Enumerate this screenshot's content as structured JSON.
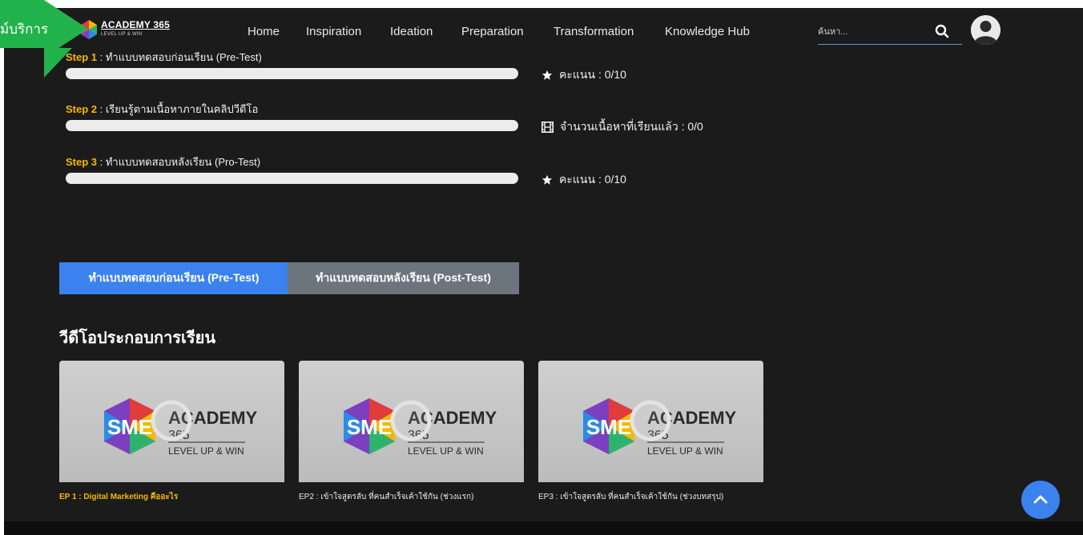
{
  "nav": {
    "brand": "ACADEMY 365",
    "tagline": "LEVEL UP & WIN",
    "links": [
      "Home",
      "Inspiration",
      "Ideation",
      "Preparation",
      "Transformation",
      "Knowledge Hub"
    ],
    "search_placeholder": "ค้นหา..."
  },
  "overlay": {
    "text": "ม์บริการ"
  },
  "steps": [
    {
      "number": "Step 1",
      "title": " : ทำแบบทดสอบก่อนเรียน (Pre-Test)",
      "meta_icon": "star-icon",
      "meta": "คะแนน : 0/10",
      "progress": 0
    },
    {
      "number": "Step 2",
      "title": " : เรียนรู้ตามเนื้อหาภายในคลิปวีดีโอ",
      "meta_icon": "film-icon",
      "meta": "จำนวนเนื้อหาที่เรียนแล้ว : 0/0",
      "progress": 0
    },
    {
      "number": "Step 3",
      "title": " : ทำแบบทดสอบหลังเรียน (Pro-Test)",
      "meta_icon": "star-icon",
      "meta": "คะแนน : 0/10",
      "progress": 0
    }
  ],
  "buttons": {
    "pre_test": "ทำแบบทดสอบก่อนเรียน (Pre-Test)",
    "post_test": "ทำแบบทดสอบหลังเรียน (Post-Test)"
  },
  "videos": {
    "section_title": "วีดีโอประกอบการเรียน",
    "thumbnail_logo": {
      "left": "SME",
      "right": "ACADEMY",
      "middle": "365",
      "bottom": "LEVEL UP & WIN"
    },
    "items": [
      {
        "title": "EP 1 : Digital Marketing คืออะไร",
        "active": true
      },
      {
        "title": "EP2 : เข้าใจสูตรลับ ที่คนสำเร็จเค้าใช้กัน (ช่วงแรก)",
        "active": false
      },
      {
        "title": "EP3 : เข้าใจสูตรลับ ที่คนสำเร็จเค้าใช้กัน (ช่วงบทสรุป)",
        "active": false
      }
    ]
  },
  "colors": {
    "background": "#1b1b1b",
    "accent": "#3b82ee",
    "step_highlight": "#f5b800",
    "secondary_button": "#6c757d",
    "overlay_green": "#22b24c"
  }
}
